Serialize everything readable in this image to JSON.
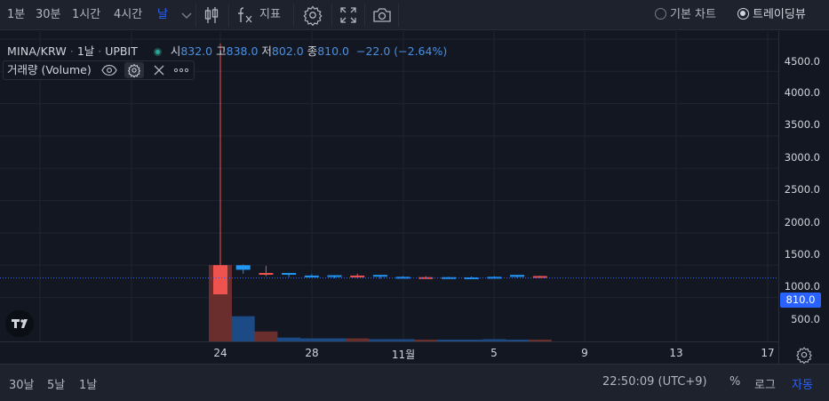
{
  "toolbar": {
    "intervals": [
      "1분",
      "30분",
      "1시간",
      "4시간",
      "날"
    ],
    "active_interval": "날",
    "indicators_label": "지표",
    "chart_type_basic": "기본 차트",
    "chart_type_tradingview": "트레이딩뷰",
    "selected_chart_type": "트레이딩뷰"
  },
  "legend": {
    "symbol": "MINA/KRW",
    "interval": "1날",
    "exchange": "UPBIT",
    "open_label": "시",
    "open": "832.0",
    "high_label": "고",
    "high": "838.0",
    "low_label": "저",
    "low": "802.0",
    "close_label": "종",
    "close": "810.0",
    "change": "−22.0 (−2.64%)",
    "market_status_color": "#26a69a"
  },
  "volume_pane": {
    "label": "거래량 (Volume)"
  },
  "price_axis": {
    "ticks": [
      "4500.0",
      "4000.0",
      "3500.0",
      "3000.0",
      "2500.0",
      "2000.0",
      "1500.0",
      "1000.0",
      "500.0"
    ],
    "last_price": "810.0"
  },
  "time_axis": {
    "ticks": [
      "24",
      "28",
      "11월",
      "5",
      "9",
      "13",
      "17"
    ]
  },
  "bottom": {
    "ranges": [
      "30날",
      "5날",
      "1날"
    ],
    "clock": "22:50:09 (UTC+9)",
    "percent_label": "%",
    "log_label": "로그",
    "auto_label": "자동"
  },
  "colors": {
    "up": "#2196f3",
    "down": "#ef5350",
    "up_volume": "#1c4a85",
    "down_volume": "#6a2f2c",
    "accent": "#2962ff",
    "background": "#131722",
    "grid": "#1f2430"
  },
  "chart_data": {
    "type": "candlestick",
    "price_ylim": [
      0,
      4700
    ],
    "x_dates": [
      "10-24",
      "10-25",
      "10-26",
      "10-27",
      "10-28",
      "10-29",
      "10-30",
      "10-31",
      "11-01",
      "11-02",
      "11-03",
      "11-04",
      "11-05",
      "11-06",
      "11-07"
    ],
    "open": [
      1000,
      930,
      880,
      855,
      840,
      830,
      840,
      830,
      820,
      815,
      805,
      810,
      812,
      820,
      832
    ],
    "high": [
      4430,
      1010,
      990,
      880,
      860,
      845,
      870,
      850,
      830,
      830,
      820,
      825,
      830,
      850,
      838
    ],
    "low": [
      580,
      870,
      830,
      815,
      810,
      800,
      795,
      790,
      800,
      790,
      790,
      795,
      800,
      805,
      802
    ],
    "close": [
      550,
      1000,
      870,
      880,
      840,
      845,
      815,
      850,
      820,
      808,
      815,
      812,
      820,
      850,
      810
    ],
    "volume_relative": [
      1.0,
      0.33,
      0.13,
      0.05,
      0.04,
      0.04,
      0.04,
      0.03,
      0.03,
      0.02,
      0.02,
      0.02,
      0.03,
      0.02,
      0.02
    ]
  }
}
